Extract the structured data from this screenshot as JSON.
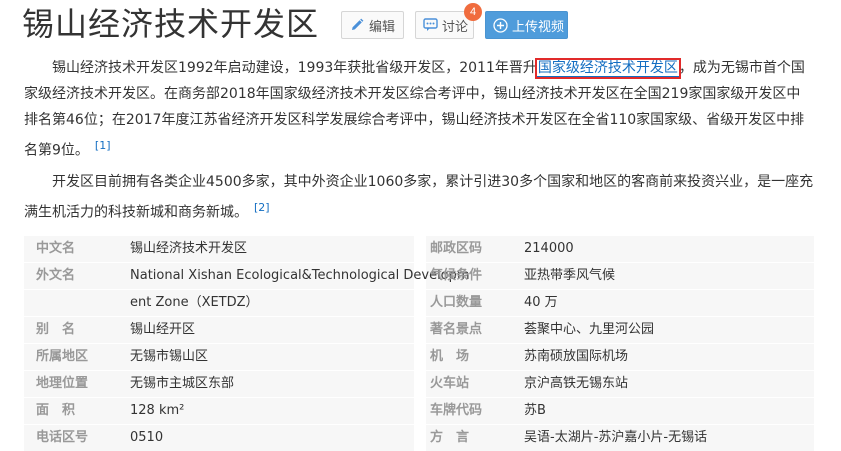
{
  "header": {
    "title": "锡山经济技术开发区",
    "edit_label": "编辑",
    "discuss_label": "讨论",
    "discuss_count": "4",
    "upload_label": "上传视频"
  },
  "intro": {
    "p1_before": "锡山经济技术开发区1992年启动建设，1993年获批省级开发区，2011年晋升",
    "p1_link": "国家级经济技术开发区",
    "p1_after": "，成为无锡市首个国家级经济技术开发区。在商务部2018年国家级经济技术开发区综合考评中，锡山经济技术开发区在全国219家国家级开发区中排名第46位；在2017年度江苏省经济开发区科学发展综合考评中，锡山经济技术开发区在全省110家国家级、省级开发区中排名第9位。",
    "p1_ref": "[1]",
    "p2_text": "开发区目前拥有各类企业4500多家，其中外资企业1060多家，累计引进30多个国家和地区的客商前来投资兴业，是一座充满生机活力的科技新城和商务新城。",
    "p2_ref": "[2]"
  },
  "basic_info": {
    "left": [
      {
        "key": "中文名",
        "value": "锡山经济技术开发区"
      },
      {
        "key": "外文名",
        "value": "National Xishan Ecological&Technological Developm"
      },
      {
        "key": "",
        "value": "ent Zone（XETDZ）"
      },
      {
        "key": "别　名",
        "value": "锡山经开区"
      },
      {
        "key": "所属地区",
        "value": "无锡市锡山区"
      },
      {
        "key": "地理位置",
        "value": "无锡市主城区东部"
      },
      {
        "key": "面　积",
        "value": "128 km²"
      },
      {
        "key": "电话区号",
        "value": "0510"
      }
    ],
    "right": [
      {
        "key": "邮政区码",
        "value": "214000"
      },
      {
        "key": "气候条件",
        "value": "亚热带季风气候"
      },
      {
        "key": "人口数量",
        "value": "40 万"
      },
      {
        "key": "著名景点",
        "value": "荟聚中心、九里河公园"
      },
      {
        "key": "机　场",
        "value": "苏南硕放国际机场"
      },
      {
        "key": "火车站",
        "value": "京沪高铁无锡东站"
      },
      {
        "key": "车牌代码",
        "value": "苏B"
      },
      {
        "key": "方　言",
        "value": "吴语-太湖片-苏沪嘉小片-无锡话"
      }
    ]
  },
  "colors": {
    "accent": "#136ec2",
    "upload_button": "#4f9cdb",
    "badge": "#f06c3e",
    "highlight_box": "#e12a2a"
  },
  "icons": {
    "edit": "pencil-icon",
    "discuss": "chat-bubble-icon",
    "upload": "plus-circle-icon"
  }
}
